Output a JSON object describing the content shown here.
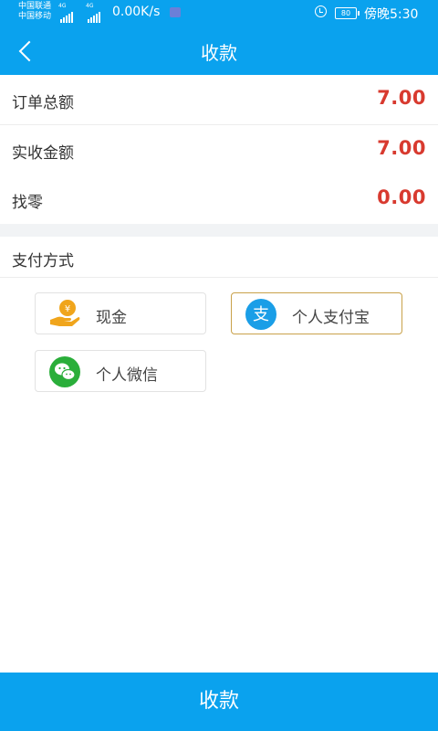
{
  "status_bar": {
    "carrier1": "中国联通",
    "carrier2": "中国移动",
    "net1": "4G",
    "net2": "4G",
    "speed": "0.00K/s",
    "battery": "80",
    "time": "傍晚5:30"
  },
  "nav": {
    "title": "收款"
  },
  "rows": [
    {
      "label": "订单总额",
      "value": "7.00"
    },
    {
      "label": "实收金额",
      "value": "7.00"
    },
    {
      "label": "找零",
      "value": "0.00"
    }
  ],
  "payment": {
    "title": "支付方式",
    "options": [
      {
        "label": "现金",
        "icon": "cash-hand-icon",
        "selected": false
      },
      {
        "label": "个人支付宝",
        "icon": "alipay-icon",
        "selected": true
      },
      {
        "label": "个人微信",
        "icon": "wechat-icon",
        "selected": false
      }
    ]
  },
  "submit_label": "收款",
  "colors": {
    "primary": "#0aa2ee",
    "amount": "#d83a2f",
    "selected_border": "#c9a14a",
    "alipay": "#1a9ee7",
    "wechat": "#2aae3a",
    "cash": "#f0a51c"
  }
}
